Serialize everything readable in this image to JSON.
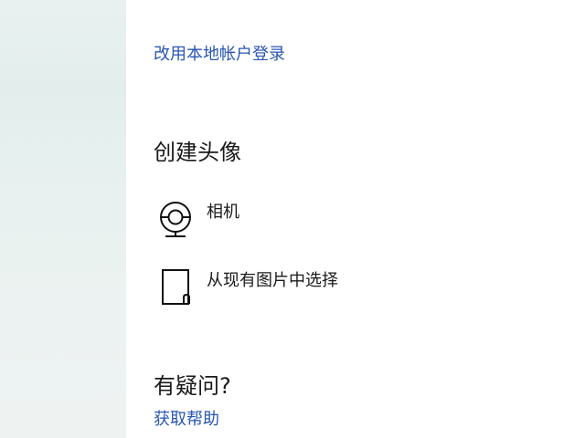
{
  "account": {
    "local_signin_link": "改用本地帐户登录"
  },
  "avatar": {
    "title": "创建头像",
    "options": [
      {
        "label": "相机",
        "icon": "camera-icon"
      },
      {
        "label": "从现有图片中选择",
        "icon": "document-icon"
      }
    ]
  },
  "questions": {
    "title": "有疑问?",
    "help_link": "获取帮助"
  },
  "colors": {
    "link": "#2956b2",
    "text": "#1a1a1a",
    "sidebar": "#e6efed"
  }
}
